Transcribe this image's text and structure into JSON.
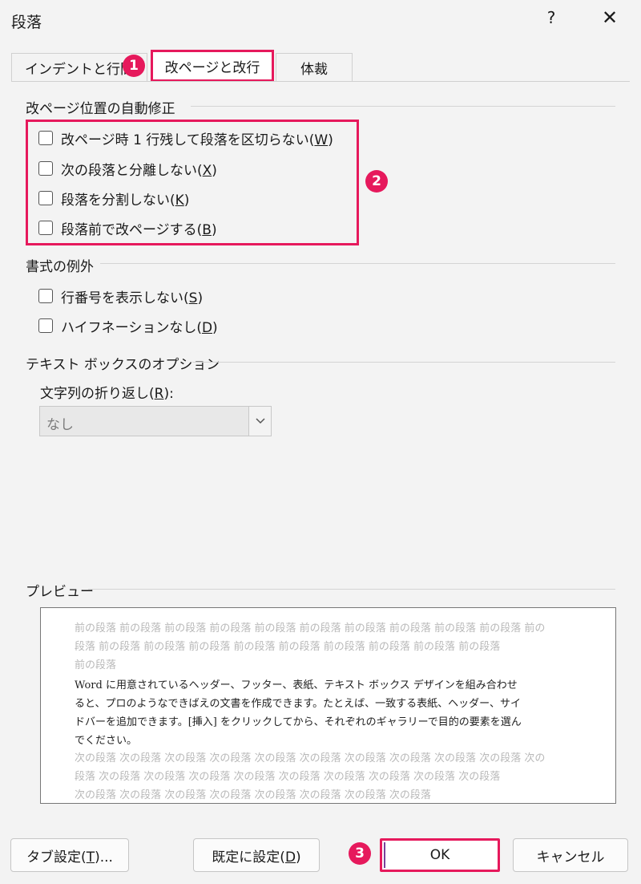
{
  "window": {
    "title": "段落",
    "help_label": "?",
    "close_label": "✕"
  },
  "tabs": [
    {
      "label": "インデントと行間"
    },
    {
      "label": "改ページと改行"
    },
    {
      "label": "体裁"
    }
  ],
  "badges": [
    "1",
    "2",
    "3"
  ],
  "pagination": {
    "title": "改ページ位置の自動修正",
    "items": [
      {
        "text": "改ページ時 1 行残して段落を区切らない(",
        "key": "W",
        "checked": false
      },
      {
        "text": "次の段落と分離しない(",
        "key": "X",
        "checked": false
      },
      {
        "text": "段落を分割しない(",
        "key": "K",
        "checked": false
      },
      {
        "text": "段落前で改ページする(",
        "key": "B",
        "checked": false
      }
    ]
  },
  "exceptions": {
    "title": "書式の例外",
    "items": [
      {
        "text": "行番号を表示しない(",
        "key": "S",
        "checked": false
      },
      {
        "text": "ハイフネーションなし(",
        "key": "D",
        "checked": false
      }
    ]
  },
  "textbox": {
    "title": "テキスト ボックスのオプション",
    "wrap_label_pre": "文字列の折り返し(",
    "wrap_label_key": "R",
    "wrap_label_post": "):",
    "wrap_value": "なし"
  },
  "preview": {
    "title": "プレビュー",
    "before_lines": [
      "前の段落 前の段落 前の段落 前の段落 前の段落 前の段落 前の段落 前の段落 前の段落 前の段落 前の",
      "段落 前の段落 前の段落 前の段落 前の段落 前の段落 前の段落 前の段落 前の段落 前の段落",
      "前の段落"
    ],
    "main_lines": [
      "Word に用意されているヘッダー、フッター、表紙、テキスト ボックス デザインを組み合わせ",
      "ると、プロのようなできばえの文書を作成できます。たとえば、一致する表紙、ヘッダー、サイ",
      "ドバーを追加できます。[挿入] をクリックしてから、それぞれのギャラリーで目的の要素を選ん",
      "でください。"
    ],
    "after_lines": [
      "次の段落 次の段落 次の段落 次の段落 次の段落 次の段落 次の段落 次の段落 次の段落 次の段落 次の",
      "段落 次の段落 次の段落 次の段落 次の段落 次の段落 次の段落 次の段落 次の段落 次の段落",
      "次の段落 次の段落 次の段落 次の段落 次の段落 次の段落 次の段落 次の段落"
    ]
  },
  "buttons": {
    "tabs_pre": "タブ設定(",
    "tabs_key": "T",
    "tabs_post": ")...",
    "default_pre": "既定に設定(",
    "default_key": "D",
    "default_post": ")",
    "ok": "OK",
    "cancel": "キャンセル"
  },
  "colors": {
    "highlight": "#e6195c"
  }
}
